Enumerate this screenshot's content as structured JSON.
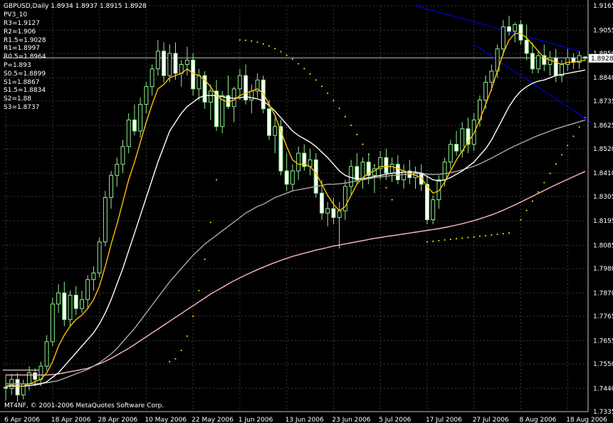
{
  "header": {
    "symbol_line": "GBPUSD,Daily  1.8934 1.8937 1.8915 1.8928",
    "indicator": "PV3_10",
    "pivots": [
      "R3=1.9127",
      "R2=1.906",
      "R1.5=1.9028",
      "R1=1.8997",
      "R0.5=1.8964",
      "P=1.893",
      "S0.5=1.8899",
      "S1=1.8867",
      "S1.5=1.8834",
      "S2=1.88",
      "S3=1.8737"
    ]
  },
  "copyright": "MT4NF, © 2001-2006 MetaQuotes Software Corp.",
  "colors": {
    "background": "#000000",
    "grid": "#3a3a3a",
    "axis": "#c0c0c0",
    "bull": "#90ee90",
    "bear": "#ffffff",
    "candle_wick": "#90ee90",
    "ma_fast": "#ffc000",
    "ma_mid": "#ffffff",
    "ma_slow": "#a9a9a9",
    "ma_long": "#ffb6c1",
    "sar": "#ffff00",
    "channel": "#0000ff",
    "price_tag_bg": "#ffffff",
    "price_tag_text": "#000000"
  },
  "chart_data": {
    "type": "candlestick",
    "title": "GBPUSD,Daily",
    "ylim": [
      1.7335,
      1.9165
    ],
    "y_ticks": [
      1.9165,
      1.9055,
      1.895,
      1.884,
      1.8735,
      1.8625,
      1.852,
      1.841,
      1.8305,
      1.8195,
      1.8085,
      1.798,
      1.787,
      1.7765,
      1.7655,
      1.755,
      1.744,
      1.7335
    ],
    "x_tick_labels": [
      "6 Apr 2006",
      "18 Apr 2006",
      "28 Apr 2006",
      "10 May 2006",
      "22 May 2006",
      "1 Jun 2006",
      "13 Jun 2006",
      "23 Jun 2006",
      "5 Jul 2006",
      "17 Jul 2006",
      "27 Jul 2006",
      "8 Aug 2006",
      "18 Aug 2006"
    ],
    "x_tick_bar_index": [
      0,
      8,
      16,
      24,
      32,
      40,
      48,
      56,
      64,
      72,
      80,
      88,
      96
    ],
    "current_price": "1.8928",
    "pivot_level": 1.893,
    "ohlc": [
      [
        1.7445,
        1.75,
        1.7385,
        1.744
      ],
      [
        1.744,
        1.7505,
        1.741,
        1.748
      ],
      [
        1.748,
        1.751,
        1.738,
        1.741
      ],
      [
        1.741,
        1.748,
        1.739,
        1.746
      ],
      [
        1.746,
        1.754,
        1.743,
        1.751
      ],
      [
        1.751,
        1.753,
        1.745,
        1.748
      ],
      [
        1.748,
        1.756,
        1.745,
        1.754
      ],
      [
        1.754,
        1.768,
        1.752,
        1.765
      ],
      [
        1.765,
        1.785,
        1.763,
        1.782
      ],
      [
        1.782,
        1.791,
        1.778,
        1.787
      ],
      [
        1.787,
        1.792,
        1.772,
        1.775
      ],
      [
        1.775,
        1.788,
        1.772,
        1.786
      ],
      [
        1.786,
        1.79,
        1.777,
        1.78
      ],
      [
        1.78,
        1.788,
        1.778,
        1.784
      ],
      [
        1.784,
        1.795,
        1.78,
        1.793
      ],
      [
        1.793,
        1.799,
        1.788,
        1.796
      ],
      [
        1.796,
        1.812,
        1.794,
        1.81
      ],
      [
        1.81,
        1.833,
        1.808,
        1.83
      ],
      [
        1.83,
        1.842,
        1.825,
        1.84
      ],
      [
        1.84,
        1.848,
        1.835,
        1.845
      ],
      [
        1.845,
        1.856,
        1.841,
        1.853
      ],
      [
        1.853,
        1.868,
        1.85,
        1.865
      ],
      [
        1.865,
        1.872,
        1.858,
        1.86
      ],
      [
        1.86,
        1.875,
        1.857,
        1.872
      ],
      [
        1.872,
        1.882,
        1.868,
        1.88
      ],
      [
        1.88,
        1.89,
        1.876,
        1.888
      ],
      [
        1.888,
        1.901,
        1.885,
        1.896
      ],
      [
        1.896,
        1.9,
        1.882,
        1.885
      ],
      [
        1.885,
        1.899,
        1.882,
        1.895
      ],
      [
        1.895,
        1.9,
        1.883,
        1.886
      ],
      [
        1.886,
        1.892,
        1.88,
        1.89
      ],
      [
        1.89,
        1.898,
        1.885,
        1.892
      ],
      [
        1.892,
        1.895,
        1.876,
        1.879
      ],
      [
        1.879,
        1.888,
        1.874,
        1.885
      ],
      [
        1.885,
        1.887,
        1.87,
        1.873
      ],
      [
        1.873,
        1.881,
        1.865,
        1.878
      ],
      [
        1.878,
        1.883,
        1.86,
        1.862
      ],
      [
        1.862,
        1.878,
        1.859,
        1.876
      ],
      [
        1.876,
        1.885,
        1.87,
        1.871
      ],
      [
        1.871,
        1.88,
        1.864,
        1.879
      ],
      [
        1.879,
        1.888,
        1.874,
        1.885
      ],
      [
        1.885,
        1.89,
        1.872,
        1.874
      ],
      [
        1.874,
        1.881,
        1.868,
        1.878
      ],
      [
        1.878,
        1.886,
        1.875,
        1.883
      ],
      [
        1.883,
        1.885,
        1.868,
        1.87
      ],
      [
        1.87,
        1.874,
        1.856,
        1.858
      ],
      [
        1.858,
        1.866,
        1.85,
        1.862
      ],
      [
        1.862,
        1.865,
        1.84,
        1.842
      ],
      [
        1.842,
        1.85,
        1.833,
        1.836
      ],
      [
        1.836,
        1.845,
        1.833,
        1.842
      ],
      [
        1.842,
        1.853,
        1.838,
        1.85
      ],
      [
        1.85,
        1.854,
        1.842,
        1.844
      ],
      [
        1.844,
        1.852,
        1.84,
        1.847
      ],
      [
        1.847,
        1.85,
        1.83,
        1.832
      ],
      [
        1.832,
        1.838,
        1.82,
        1.823
      ],
      [
        1.823,
        1.828,
        1.817,
        1.825
      ],
      [
        1.825,
        1.83,
        1.818,
        1.821
      ],
      [
        1.821,
        1.828,
        1.807,
        1.824
      ],
      [
        1.824,
        1.838,
        1.82,
        1.835
      ],
      [
        1.835,
        1.847,
        1.831,
        1.844
      ],
      [
        1.844,
        1.85,
        1.836,
        1.838
      ],
      [
        1.838,
        1.848,
        1.834,
        1.846
      ],
      [
        1.846,
        1.85,
        1.836,
        1.84
      ],
      [
        1.84,
        1.845,
        1.832,
        1.843
      ],
      [
        1.843,
        1.851,
        1.838,
        1.848
      ],
      [
        1.848,
        1.852,
        1.838,
        1.841
      ],
      [
        1.841,
        1.848,
        1.837,
        1.845
      ],
      [
        1.845,
        1.849,
        1.836,
        1.838
      ],
      [
        1.838,
        1.845,
        1.834,
        1.842
      ],
      [
        1.842,
        1.847,
        1.836,
        1.839
      ],
      [
        1.839,
        1.844,
        1.834,
        1.841
      ],
      [
        1.841,
        1.845,
        1.833,
        1.836
      ],
      [
        1.836,
        1.84,
        1.818,
        1.82
      ],
      [
        1.82,
        1.831,
        1.818,
        1.829
      ],
      [
        1.829,
        1.84,
        1.825,
        1.838
      ],
      [
        1.838,
        1.848,
        1.835,
        1.846
      ],
      [
        1.846,
        1.856,
        1.843,
        1.854
      ],
      [
        1.854,
        1.86,
        1.849,
        1.851
      ],
      [
        1.851,
        1.864,
        1.848,
        1.861
      ],
      [
        1.861,
        1.866,
        1.85,
        1.854
      ],
      [
        1.854,
        1.868,
        1.851,
        1.865
      ],
      [
        1.865,
        1.876,
        1.862,
        1.874
      ],
      [
        1.874,
        1.885,
        1.87,
        1.882
      ],
      [
        1.882,
        1.89,
        1.878,
        1.887
      ],
      [
        1.887,
        1.899,
        1.884,
        1.897
      ],
      [
        1.897,
        1.91,
        1.894,
        1.907
      ],
      [
        1.907,
        1.912,
        1.903,
        1.905
      ],
      [
        1.905,
        1.909,
        1.9,
        1.908
      ],
      [
        1.908,
        1.91,
        1.899,
        1.901
      ],
      [
        1.901,
        1.908,
        1.892,
        1.895
      ],
      [
        1.895,
        1.9,
        1.886,
        1.888
      ],
      [
        1.888,
        1.896,
        1.886,
        1.894
      ],
      [
        1.894,
        1.899,
        1.887,
        1.89
      ],
      [
        1.89,
        1.896,
        1.885,
        1.893
      ],
      [
        1.893,
        1.897,
        1.882,
        1.885
      ],
      [
        1.885,
        1.892,
        1.882,
        1.89
      ],
      [
        1.89,
        1.897,
        1.887,
        1.893
      ],
      [
        1.893,
        1.895,
        1.888,
        1.891
      ],
      [
        1.891,
        1.896,
        1.888,
        1.894
      ],
      [
        1.8934,
        1.8937,
        1.8915,
        1.8928
      ]
    ],
    "ma_fast_values": [
      1.745,
      1.7455,
      1.745,
      1.745,
      1.746,
      1.747,
      1.748,
      1.751,
      1.756,
      1.763,
      1.768,
      1.772,
      1.775,
      1.777,
      1.78,
      1.784,
      1.79,
      1.799,
      1.809,
      1.818,
      1.828,
      1.838,
      1.846,
      1.855,
      1.864,
      1.872,
      1.879,
      1.881,
      1.884,
      1.885,
      1.886,
      1.888,
      1.886,
      1.885,
      1.883,
      1.88,
      1.876,
      1.874,
      1.873,
      1.874,
      1.876,
      1.877,
      1.878,
      1.879,
      1.877,
      1.872,
      1.867,
      1.86,
      1.853,
      1.847,
      1.845,
      1.845,
      1.844,
      1.841,
      1.836,
      1.831,
      1.827,
      1.824,
      1.826,
      1.831,
      1.836,
      1.839,
      1.841,
      1.842,
      1.844,
      1.844,
      1.844,
      1.843,
      1.842,
      1.841,
      1.84,
      1.839,
      1.835,
      1.832,
      1.833,
      1.837,
      1.842,
      1.847,
      1.851,
      1.855,
      1.859,
      1.865,
      1.872,
      1.879,
      1.887,
      1.895,
      1.901,
      1.904,
      1.904,
      1.902,
      1.899,
      1.896,
      1.893,
      1.892,
      1.891,
      1.89,
      1.891,
      1.891,
      1.8915,
      1.892
    ],
    "ma_mid_values": [
      1.745,
      1.745,
      1.745,
      1.745,
      1.7452,
      1.7455,
      1.746,
      1.747,
      1.749,
      1.751,
      1.754,
      1.757,
      1.76,
      1.763,
      1.766,
      1.769,
      1.773,
      1.778,
      1.784,
      1.791,
      1.798,
      1.806,
      1.814,
      1.822,
      1.83,
      1.838,
      1.846,
      1.853,
      1.86,
      1.864,
      1.868,
      1.871,
      1.873,
      1.875,
      1.876,
      1.876,
      1.876,
      1.8755,
      1.875,
      1.8748,
      1.875,
      1.8755,
      1.875,
      1.8745,
      1.8735,
      1.8715,
      1.869,
      1.866,
      1.863,
      1.86,
      1.858,
      1.8565,
      1.855,
      1.853,
      1.8505,
      1.848,
      1.845,
      1.842,
      1.84,
      1.839,
      1.8385,
      1.8385,
      1.839,
      1.8395,
      1.84,
      1.8405,
      1.841,
      1.8412,
      1.8414,
      1.8415,
      1.8415,
      1.841,
      1.8395,
      1.838,
      1.8375,
      1.838,
      1.839,
      1.8405,
      1.842,
      1.844,
      1.846,
      1.849,
      1.852,
      1.856,
      1.861,
      1.866,
      1.871,
      1.875,
      1.878,
      1.88,
      1.8815,
      1.8825,
      1.883,
      1.884,
      1.885,
      1.8855,
      1.886,
      1.8865,
      1.887,
      1.8875
    ],
    "ma_slow_values": [
      1.746,
      1.746,
      1.746,
      1.746,
      1.746,
      1.746,
      1.7462,
      1.7465,
      1.747,
      1.7475,
      1.7485,
      1.7495,
      1.7505,
      1.7515,
      1.7525,
      1.754,
      1.7555,
      1.7575,
      1.7595,
      1.762,
      1.765,
      1.768,
      1.771,
      1.7745,
      1.778,
      1.7815,
      1.785,
      1.7885,
      1.792,
      1.795,
      1.798,
      1.801,
      1.804,
      1.8065,
      1.809,
      1.811,
      1.813,
      1.815,
      1.817,
      1.819,
      1.821,
      1.823,
      1.8245,
      1.826,
      1.827,
      1.8285,
      1.83,
      1.831,
      1.832,
      1.833,
      1.8335,
      1.834,
      1.8345,
      1.835,
      1.8355,
      1.836,
      1.836,
      1.8362,
      1.8365,
      1.837,
      1.8375,
      1.838,
      1.8385,
      1.839,
      1.8393,
      1.8396,
      1.84,
      1.8402,
      1.8404,
      1.8406,
      1.8408,
      1.8408,
      1.8406,
      1.8404,
      1.8405,
      1.8408,
      1.8412,
      1.8418,
      1.8425,
      1.8433,
      1.8441,
      1.8452,
      1.8465,
      1.8478,
      1.8492,
      1.8506,
      1.852,
      1.8533,
      1.8545,
      1.8557,
      1.8569,
      1.858,
      1.859,
      1.86,
      1.861,
      1.8618,
      1.8626,
      1.8634,
      1.8642,
      1.865
    ],
    "ma_long_values": [
      1.75,
      1.75,
      1.75,
      1.75,
      1.75,
      1.75,
      1.75,
      1.75,
      1.7502,
      1.7505,
      1.751,
      1.7515,
      1.752,
      1.7525,
      1.753,
      1.754,
      1.755,
      1.7562,
      1.7575,
      1.759,
      1.7605,
      1.762,
      1.7637,
      1.7655,
      1.7672,
      1.769,
      1.7707,
      1.7725,
      1.7742,
      1.776,
      1.7777,
      1.7795,
      1.7812,
      1.783,
      1.7847,
      1.7865,
      1.788,
      1.7895,
      1.791,
      1.7925,
      1.7938,
      1.7951,
      1.7963,
      1.7975,
      1.7986,
      1.7997,
      1.8007,
      1.8017,
      1.8026,
      1.8035,
      1.8042,
      1.8049,
      1.8056,
      1.8063,
      1.8069,
      1.8075,
      1.8081,
      1.8086,
      1.8091,
      1.8096,
      1.8101,
      1.8106,
      1.8111,
      1.8116,
      1.812,
      1.8124,
      1.8128,
      1.8132,
      1.8136,
      1.814,
      1.8144,
      1.8148,
      1.8152,
      1.8156,
      1.816,
      1.8165,
      1.817,
      1.8176,
      1.8182,
      1.8189,
      1.8196,
      1.8204,
      1.8213,
      1.8222,
      1.8232,
      1.8243,
      1.8255,
      1.8267,
      1.828,
      1.8293,
      1.8306,
      1.8319,
      1.8332,
      1.8345,
      1.8358,
      1.837,
      1.8382,
      1.8394,
      1.8406,
      1.8418
    ],
    "sar_values": [
      null,
      null,
      null,
      null,
      null,
      null,
      null,
      null,
      null,
      null,
      null,
      null,
      null,
      null,
      null,
      null,
      null,
      null,
      null,
      null,
      null,
      null,
      null,
      null,
      null,
      null,
      null,
      null,
      null,
      null,
      null,
      null,
      null,
      null,
      null,
      null,
      null,
      null,
      null,
      null,
      null,
      null,
      null,
      null,
      null,
      null,
      null,
      null,
      null,
      null,
      null,
      null,
      null,
      null,
      null,
      null,
      null,
      null,
      null,
      null,
      null,
      null,
      null,
      null,
      null,
      null,
      null,
      null,
      null,
      null,
      null,
      null,
      null,
      null,
      null,
      null,
      null,
      null,
      null,
      null,
      null,
      null,
      null,
      null,
      null,
      null,
      null,
      null,
      null,
      null,
      null,
      null,
      null,
      null,
      null,
      null,
      null,
      null,
      null,
      null
    ],
    "channel_upper": [
      [
        70,
        1.9165
      ],
      [
        98,
        1.896
      ]
    ],
    "channel_lower": [
      [
        80,
        1.899
      ],
      [
        100,
        1.864
      ]
    ]
  }
}
